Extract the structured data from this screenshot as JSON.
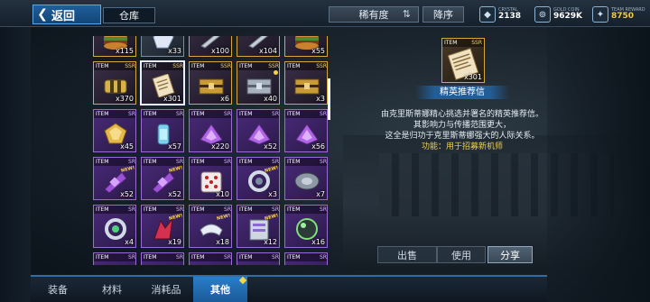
{
  "topbar": {
    "back_label": "返回",
    "tab_label": "仓库",
    "rarity_sort_label": "稀有度",
    "order_label": "降序",
    "currencies": [
      {
        "icon": "crystal-icon",
        "caption": "CRYSTAL",
        "value": "2138"
      },
      {
        "icon": "gold-coin-icon",
        "caption": "GOLD COIN",
        "value": "9629K"
      },
      {
        "icon": "team-reward-icon",
        "caption": "TEAM REWARD",
        "value": "8750"
      }
    ]
  },
  "grid": {
    "items": [
      {
        "rank": "",
        "count": "x115",
        "art": "burger",
        "rarity": "r-ssr"
      },
      {
        "rank": "",
        "count": "x33",
        "art": "crystal",
        "rarity": "r-r",
        "new": true
      },
      {
        "rank": "",
        "count": "x100",
        "art": "blade",
        "rarity": "r-ssr"
      },
      {
        "rank": "",
        "count": "x104",
        "art": "blade",
        "rarity": "r-ssr",
        "new": true
      },
      {
        "rank": "",
        "count": "x55",
        "art": "burger",
        "rarity": "r-ssr",
        "new": true
      },
      {
        "rank": "SSR",
        "count": "x370",
        "art": "gold-cylinder",
        "rarity": "r-ssr"
      },
      {
        "rank": "SSR",
        "count": "x301",
        "art": "letter",
        "rarity": "r-ssr",
        "selected": true
      },
      {
        "rank": "SSR",
        "count": "x6",
        "art": "gold-case",
        "rarity": "r-ssr"
      },
      {
        "rank": "SSR",
        "count": "x40",
        "art": "silver-case",
        "rarity": "r-ssr",
        "dot": true
      },
      {
        "rank": "SSR",
        "count": "x3",
        "art": "gold-case",
        "rarity": "r-ssr"
      },
      {
        "rank": "SR",
        "count": "x45",
        "art": "gold-gem",
        "rarity": "r-sr"
      },
      {
        "rank": "SR",
        "count": "x57",
        "art": "canister",
        "rarity": "r-sr"
      },
      {
        "rank": "SR",
        "count": "x220",
        "art": "purple-chip",
        "rarity": "r-sr"
      },
      {
        "rank": "SR",
        "count": "x52",
        "art": "purple-chip",
        "rarity": "r-sr"
      },
      {
        "rank": "SR",
        "count": "x56",
        "art": "purple-chip",
        "rarity": "r-sr"
      },
      {
        "rank": "SR",
        "count": "x52",
        "art": "purple-plate",
        "rarity": "r-sr",
        "new": true
      },
      {
        "rank": "SR",
        "count": "x52",
        "art": "purple-plate",
        "rarity": "r-sr",
        "new": true
      },
      {
        "rank": "SR",
        "count": "x10",
        "art": "dice",
        "rarity": "r-sr"
      },
      {
        "rank": "SR",
        "count": "x3",
        "art": "ring",
        "rarity": "r-sr",
        "new": true
      },
      {
        "rank": "SR",
        "count": "x7",
        "art": "disc",
        "rarity": "r-sr"
      },
      {
        "rank": "SR",
        "count": "x4",
        "art": "ring-green",
        "rarity": "r-sr"
      },
      {
        "rank": "SR",
        "count": "x19",
        "art": "red-mech",
        "rarity": "r-sr",
        "new": true
      },
      {
        "rank": "SR",
        "count": "x18",
        "art": "visor",
        "rarity": "r-sr",
        "new": true
      },
      {
        "rank": "SR",
        "count": "x12",
        "art": "scroll",
        "rarity": "r-sr",
        "new": true
      },
      {
        "rank": "SR",
        "count": "x16",
        "art": "sphere",
        "rarity": "r-sr"
      },
      {
        "rank": "SR",
        "count": "",
        "art": "ring",
        "rarity": "r-sr"
      },
      {
        "rank": "SR",
        "count": "",
        "art": "red-mech",
        "rarity": "r-sr"
      },
      {
        "rank": "SR",
        "count": "",
        "art": "purple-chip",
        "rarity": "r-sr"
      },
      {
        "rank": "SR",
        "count": "",
        "art": "purple-chip",
        "rarity": "r-sr"
      },
      {
        "rank": "SR",
        "count": "",
        "art": "disc",
        "rarity": "r-sr"
      }
    ],
    "item_tag": "ITEM",
    "new_label": "NEW!"
  },
  "detail": {
    "tag": "ITEM",
    "rank": "SSR",
    "count": "x301",
    "name": "精英推荐信",
    "desc_lines": [
      "由克里斯蒂娜精心挑选并署名的精英推荐信。",
      "其影响力与传播范围更大，",
      "这全是归功于克里斯蒂娜强大的人际关系。"
    ],
    "function_line": "功能：用于招募新机师"
  },
  "actions": {
    "sell": "出售",
    "use": "使用",
    "share": "分享"
  },
  "bottom_tabs": [
    {
      "label": "装备",
      "active": false
    },
    {
      "label": "材料",
      "active": false
    },
    {
      "label": "消耗品",
      "active": false
    },
    {
      "label": "其他",
      "active": true
    }
  ]
}
